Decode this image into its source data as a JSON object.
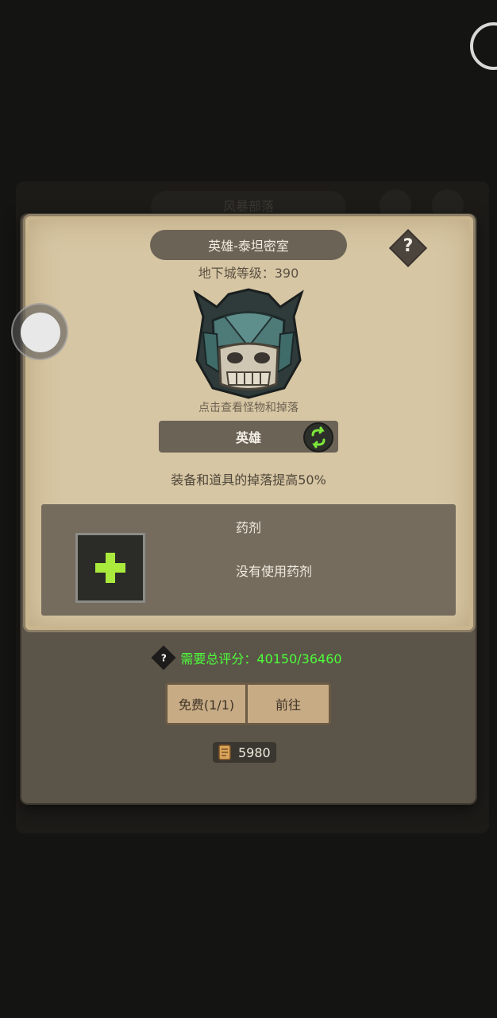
{
  "background": {
    "tab_label": "风暴部落"
  },
  "dialog": {
    "title": "英雄-泰坦密室",
    "help_symbol": "?",
    "dungeon_level": "地下城等级：390",
    "monster_hint": "点击查看怪物和掉落",
    "difficulty": "英雄",
    "difficulty_bonus": "装备和道具的掉落提高50%",
    "potion": {
      "title": "药剂",
      "empty_text": "没有使用药剂"
    },
    "requirement": {
      "help_symbol": "?",
      "text": "需要总评分：40150/36460"
    },
    "buttons": {
      "free": "免费(1/1)",
      "go": "前往"
    },
    "cost": "5980"
  },
  "colors": {
    "parchment": "#d7c6a3",
    "requirement_green": "#4dff3a",
    "button_tan": "#c7ab85"
  }
}
